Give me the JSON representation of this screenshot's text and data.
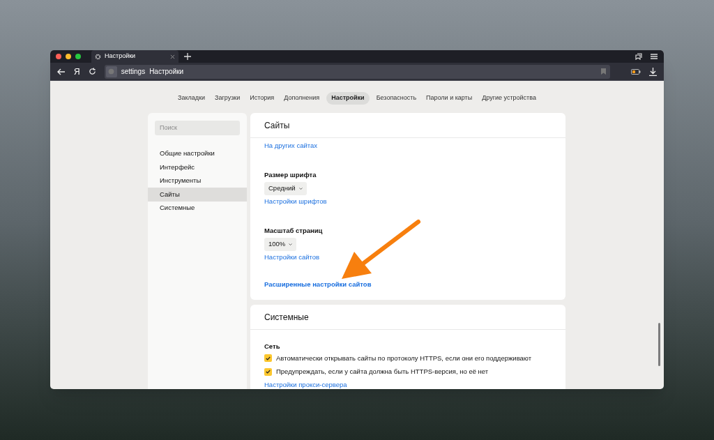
{
  "browser": {
    "tab_title": "Настройки",
    "logo_letter": "Я",
    "address_scheme": "settings",
    "address_title": "Настройки"
  },
  "nav": [
    {
      "label": "Закладки",
      "selected": false
    },
    {
      "label": "Загрузки",
      "selected": false
    },
    {
      "label": "История",
      "selected": false
    },
    {
      "label": "Дополнения",
      "selected": false
    },
    {
      "label": "Настройки",
      "selected": true
    },
    {
      "label": "Безопасность",
      "selected": false
    },
    {
      "label": "Пароли и карты",
      "selected": false
    },
    {
      "label": "Другие устройства",
      "selected": false
    }
  ],
  "sidebar": {
    "search": {
      "placeholder": "Поиск"
    },
    "items": [
      {
        "label": "Общие настройки",
        "selected": false
      },
      {
        "label": "Интерфейс",
        "selected": false
      },
      {
        "label": "Инструменты",
        "selected": false
      },
      {
        "label": "Сайты",
        "selected": true
      },
      {
        "label": "Системные",
        "selected": false
      }
    ]
  },
  "sections": [
    {
      "title": "Сайты",
      "items": [
        {
          "kind": "link",
          "text": "На других сайтах"
        },
        {
          "kind": "heading",
          "text": "Размер шрифта"
        },
        {
          "kind": "dropdown",
          "text": "Средний"
        },
        {
          "kind": "link",
          "text": "Настройки шрифтов"
        },
        {
          "kind": "heading",
          "text": "Масштаб страниц"
        },
        {
          "kind": "dropdown",
          "text": "100%"
        },
        {
          "kind": "link",
          "text": "Настройки сайтов"
        },
        {
          "kind": "strong_link",
          "text": "Расширенные настройки сайтов"
        }
      ]
    },
    {
      "title": "Системные",
      "items": [
        {
          "kind": "heading",
          "text": "Сеть"
        },
        {
          "kind": "checkbox",
          "text": "Автоматически открывать сайты по протоколу HTTPS, если они его поддерживают",
          "checked": true
        },
        {
          "kind": "checkbox",
          "text": "Предупреждать, если у сайта должна быть HTTPS-версия, но её нет",
          "checked": true
        },
        {
          "kind": "link",
          "text": "Настройки прокси-сервера"
        }
      ]
    }
  ]
}
